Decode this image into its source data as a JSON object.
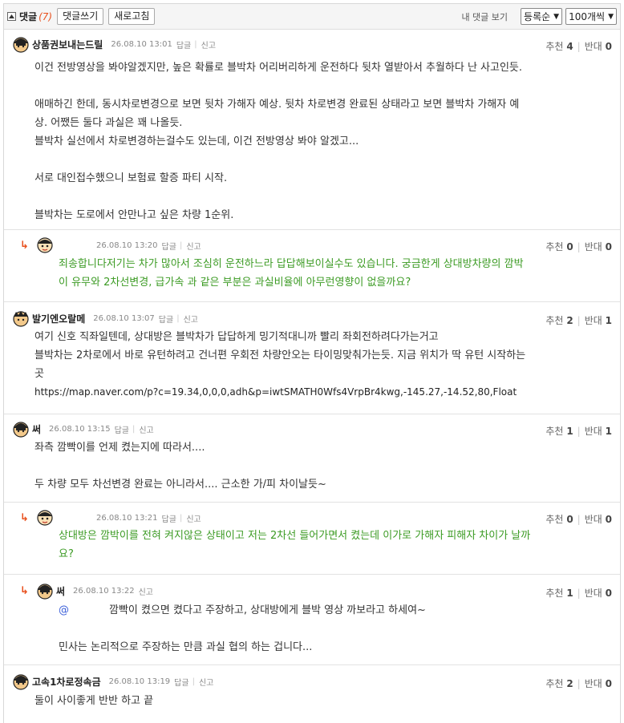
{
  "header": {
    "title": "댓글",
    "count": "(7)",
    "write_button": "댓글쓰기",
    "refresh_button": "새로고침",
    "my_comments": "내 댓글 보기",
    "sort_select": "등록순",
    "page_size_select": "100개씩"
  },
  "labels": {
    "reply": "답글",
    "report": "신고",
    "recommend": "추천",
    "oppose": "반대"
  },
  "comments": [
    {
      "nick": "상품권보내는드릴",
      "date": "26.08.10 13:01",
      "up": "4",
      "down": "0",
      "lines": [
        "이건 전방영상을 봐야알겠지만, 높은 확률로 블박차 어리버리하게 운전하다 뒷차 열받아서 추월하다 난 사고인듯.",
        "",
        "애매하긴 한데, 동시차로변경으로 보면 뒷차 가해자 예상. 뒷차 차로변경 완료된 상태라고 보면 블박차 가해자 예",
        "상. 어쨌든 둘다 과실은 꽤 나올듯.",
        "블박차 실선에서 차로변경하는걸수도 있는데, 이건 전방영상 봐야 알겠고...",
        "",
        "서로 대인접수했으니 보험료 할증 파티 시작.",
        "",
        "블박차는 도로에서 안만나고 싶은 차량 1순위."
      ]
    },
    {
      "nick": "",
      "date": "26.08.10 13:20",
      "up": "0",
      "down": "0",
      "lines": [
        "죄송합니다저기는 차가 많아서 조심히 운전하느라 답답해보이실수도 있습니다. 궁금한게 상대방차량의 깜박",
        "이 유무와 2차선변경, 급가속 과 같은 부분은 과실비율에 아무런영향이 없을까요?"
      ]
    },
    {
      "nick": "발기엔오랄메",
      "date": "26.08.10 13:07",
      "up": "2",
      "down": "1",
      "lines": [
        "여기 신호 직좌일텐데, 상대방은 블박차가 답답하게 밍기적대니까 빨리 좌회전하려다가는거고",
        "블박차는 2차로에서 바로 유턴하려고 건너편 우회전 차량안오는 타이밍맞춰가는듯. 지금 위치가 딱 유턴 시작하는",
        "곳"
      ],
      "link": "https://map.naver.com/p?c=19.34,0,0,0,adh&p=iwtSMATH0Wfs4VrpBr4kwg,-145.27,-14.52,80,Float"
    },
    {
      "nick": "써",
      "date": "26.08.10 13:15",
      "up": "1",
      "down": "1",
      "lines": [
        "좌측 깜빡이를 언제 켰는지에 따라서....",
        "",
        "두 차량 모두 차선변경 완료는 아니라서.... 근소한 가/피 차이날듯~"
      ]
    },
    {
      "nick": "",
      "date": "26.08.10 13:21",
      "up": "0",
      "down": "0",
      "lines": [
        "상대방은 깜박이를 전혀 켜지않은 상태이고 저는 2차선 들어가면서 켰는데 이가로 가해자 피해자 차이가 날까",
        "요?"
      ]
    },
    {
      "nick": "써",
      "date": "26.08.10 13:22",
      "up": "1",
      "down": "0",
      "mention": "@",
      "lines": [
        "깜빡이 켰으면 켰다고 주장하고, 상대방에게 블박 영상 까보라고 하세여~",
        "",
        "민사는 논리적으로 주장하는 만큼 과실 협의 하는 겁니다..."
      ]
    },
    {
      "nick": "고속1차로정속금",
      "date": "26.08.10 13:19",
      "up": "2",
      "down": "0",
      "lines": [
        "둘이 사이좋게 반반 하고 끝"
      ]
    }
  ]
}
